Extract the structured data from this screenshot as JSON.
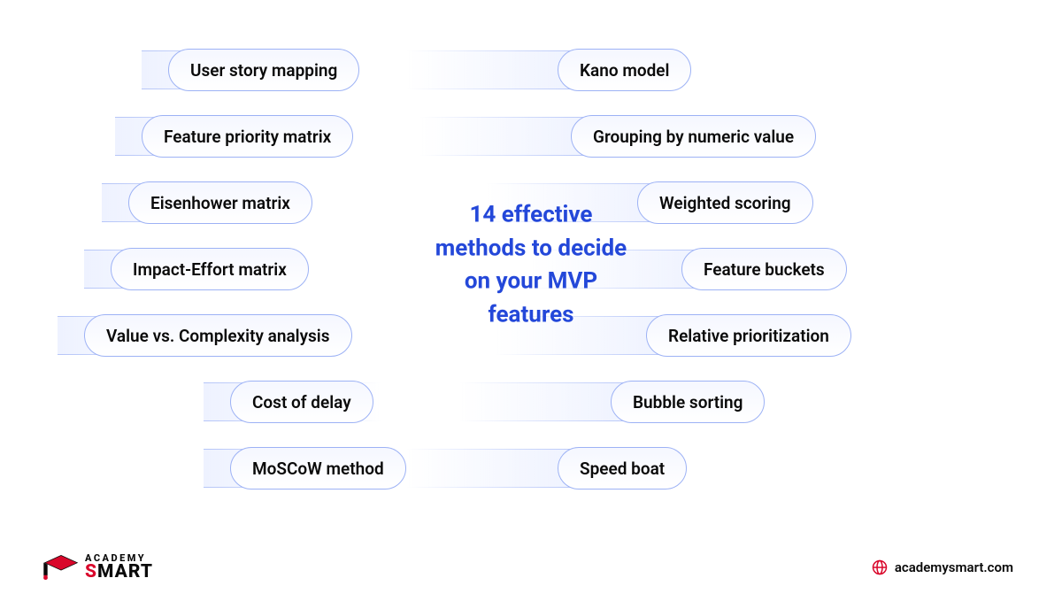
{
  "center_title": "14 effective methods to decide on your MVP features",
  "left_methods": [
    "User story mapping",
    "Feature priority matrix",
    "Eisenhower matrix",
    "Impact-Effort matrix",
    "Value vs. Complexity analysis",
    "Cost of delay",
    "MoSCoW method"
  ],
  "right_methods": [
    "Kano model",
    "Grouping by numeric value",
    "Weighted scoring",
    "Feature buckets",
    "Relative prioritization",
    "Bubble sorting",
    "Speed boat"
  ],
  "logo": {
    "line1": "ACADEMY",
    "line2_highlight": "S",
    "line2_rest": "MART"
  },
  "website": "academysmart.com"
}
